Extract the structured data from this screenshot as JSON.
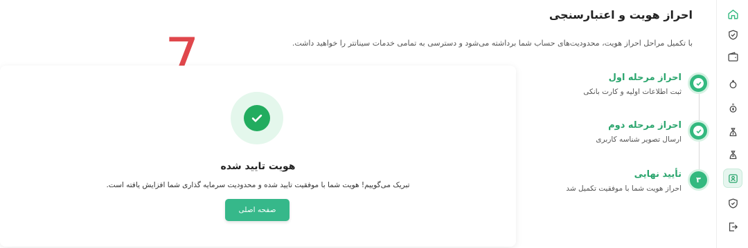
{
  "header": {
    "title": "احراز هویت و اعتبارسنجی",
    "subtitle": "با تکمیل مراحل احراز هویت، محدودیت‌های حساب شما برداشته می‌شود و دسترسی به تمامی خدمات سیناتتر را خواهید داشت."
  },
  "annotation": {
    "number": "7"
  },
  "steps": [
    {
      "title": "احراز مرحله اول",
      "description": "ثبت اطلاعات اولیه و کارت بانکی",
      "status": "completed"
    },
    {
      "title": "احراز مرحله دوم",
      "description": "ارسال تصویر شناسه کاربری",
      "status": "completed"
    },
    {
      "title": "تأیید نهایی",
      "description": "احراز هویت شما با موفقیت تکمیل شد",
      "status": "current",
      "badge": "۳"
    }
  ],
  "card": {
    "title": "هویت تایید شده",
    "message": "تبریک می‌گوییم! هویت شما با موفقیت تایید شده و محدودیت سرمایه گذاری شما افزایش یافته است.",
    "button_label": "صفحه اصلی"
  },
  "sidebar": {
    "icons": [
      "home-icon",
      "shield-check-icon",
      "wallet-icon",
      "piggy-bank-icon",
      "piggy-bank-coin-icon",
      "money-bag-icon",
      "money-bag-up-icon",
      "identity-card-icon",
      "shield-icon",
      "logout-icon"
    ],
    "active_index": 7
  },
  "colors": {
    "accent": "#36b88a",
    "step_green": "#2aa56d",
    "success_green": "#22ac5f",
    "annotation_red": "#e0474c"
  }
}
